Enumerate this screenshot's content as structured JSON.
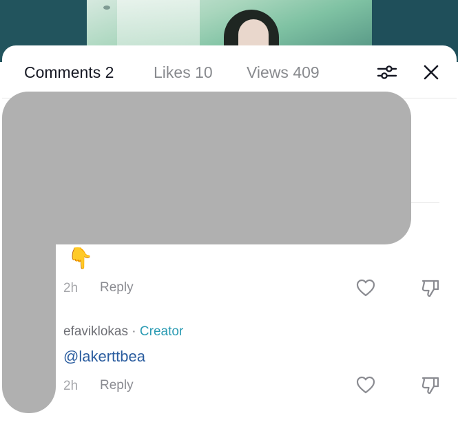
{
  "tabs": {
    "comments": "Comments 2",
    "likes": "Likes 10",
    "views": "Views 409"
  },
  "icons": {
    "filter": "sliders-icon",
    "close": "close-icon",
    "like": "heart-outline-icon",
    "dislike": "thumbs-down-icon"
  },
  "comments": [
    {
      "text": "👇",
      "time": "2h",
      "reply_label": "Reply"
    },
    {
      "author": "efaviklokas",
      "separator": "·",
      "badge": "Creator",
      "text": "@lakerttbea",
      "time": "2h",
      "reply_label": "Reply"
    }
  ],
  "colors": {
    "active_tab": "#161823",
    "inactive_tab": "#888a8e",
    "creator_badge": "#2b9bb3",
    "mention": "#2b5d9f",
    "redaction": "#b0b0b0"
  }
}
